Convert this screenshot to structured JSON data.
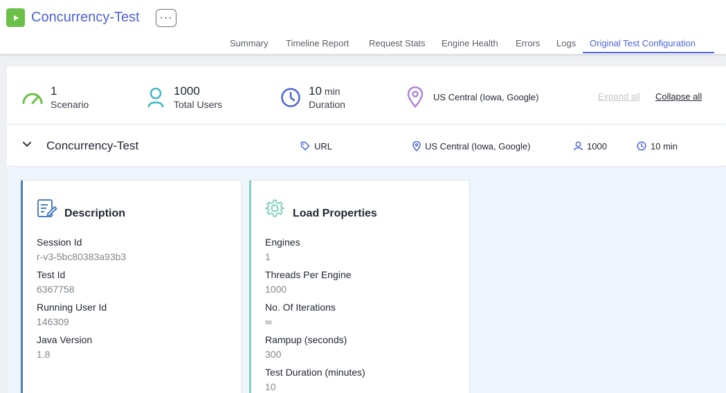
{
  "app": {
    "title": "Concurrency-Test",
    "more_label": "···"
  },
  "tabs": [
    {
      "label": "Summary"
    },
    {
      "label": "Timeline Report"
    },
    {
      "label": "Request Stats"
    },
    {
      "label": "Engine Health"
    },
    {
      "label": "Errors"
    },
    {
      "label": "Logs"
    },
    {
      "label": "Original Test Configuration",
      "active": true
    }
  ],
  "summary": {
    "scenario": {
      "value": "1",
      "label": "Scenario",
      "icon": "speedometer-icon",
      "color": "#6cc04a"
    },
    "users": {
      "value": "1000",
      "label": "Total Users",
      "icon": "user-icon",
      "color": "#3fb6c4"
    },
    "duration": {
      "value": "10",
      "unit": "min",
      "label": "Duration",
      "icon": "clock-icon",
      "color": "#4b63d6"
    },
    "location": {
      "value": "US Central (Iowa, Google)",
      "icon": "location-pin-icon",
      "color": "#b084d8"
    },
    "expand_all": "Expand all",
    "collapse_all": "Collapse all"
  },
  "scenario": {
    "name": "Concurrency-Test",
    "type": "URL",
    "location": "US Central (Iowa, Google)",
    "users": "1000",
    "duration": "10 min"
  },
  "description": {
    "title": "Description",
    "fields": [
      {
        "label": "Session Id",
        "value": "r-v3-5bc80383a93b3"
      },
      {
        "label": "Test Id",
        "value": "6367758"
      },
      {
        "label": "Running User Id",
        "value": "146309"
      },
      {
        "label": "Java Version",
        "value": "1.8"
      }
    ]
  },
  "load_properties": {
    "title": "Load Properties",
    "fields": [
      {
        "label": "Engines",
        "value": "1"
      },
      {
        "label": "Threads Per Engine",
        "value": "1000"
      },
      {
        "label": "No. Of Iterations",
        "value": "∞"
      },
      {
        "label": "Rampup (seconds)",
        "value": "300"
      },
      {
        "label": "Test Duration (minutes)",
        "value": "10"
      }
    ]
  },
  "colors": {
    "accent": "#4b63d6",
    "brand_green": "#6cc04a",
    "desc_border": "#4a7fc1",
    "load_border": "#7fd1be"
  }
}
